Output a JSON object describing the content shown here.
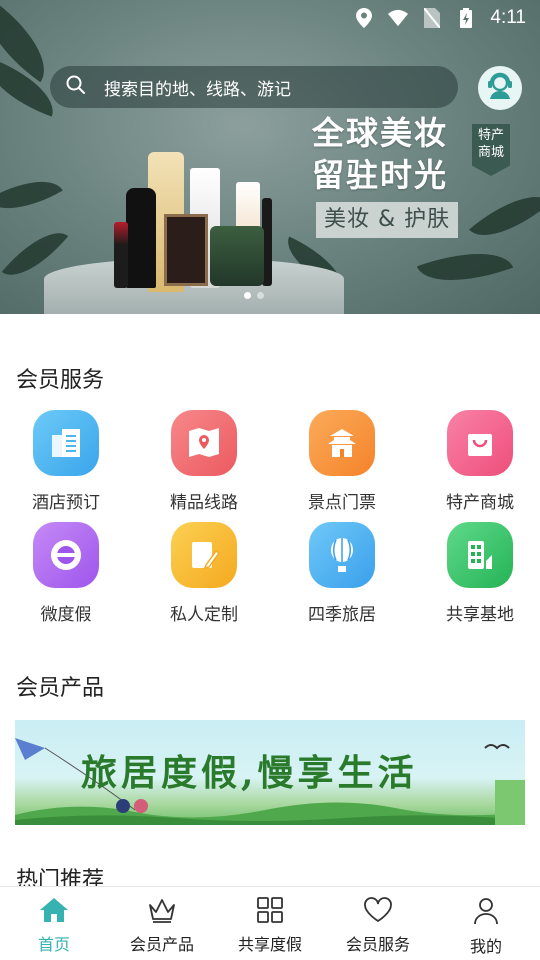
{
  "status_bar": {
    "time": "4:11"
  },
  "header": {
    "search_placeholder": "搜索目的地、线路、游记"
  },
  "banner": {
    "title_line1": "全球美妆",
    "title_line2": "留驻时光",
    "tag_line1": "特产",
    "tag_line2": "商城",
    "subtitle": "美妆 & 护肤",
    "slide_count": 2,
    "active_slide": 1
  },
  "member_services": {
    "title": "会员服务",
    "items": [
      {
        "label": "酒店预订",
        "icon": "hotel-icon",
        "color": "#4cb6ef"
      },
      {
        "label": "精品线路",
        "icon": "map-pin-icon",
        "color": "#f06a6a"
      },
      {
        "label": "景点门票",
        "icon": "temple-icon",
        "color": "#f7963d"
      },
      {
        "label": "特产商城",
        "icon": "shopping-bag-icon",
        "color": "#f35f8c"
      },
      {
        "label": "微度假",
        "icon": "eye-icon",
        "color": "#b069f0"
      },
      {
        "label": "私人定制",
        "icon": "edit-icon",
        "color": "#f7b92f"
      },
      {
        "label": "四季旅居",
        "icon": "balloon-icon",
        "color": "#48b3f2"
      },
      {
        "label": "共享基地",
        "icon": "building-icon",
        "color": "#34c36a"
      }
    ]
  },
  "member_products": {
    "title": "会员产品",
    "banner_text": "旅居度假,慢享生活"
  },
  "hot_recommend": {
    "title": "热门推荐"
  },
  "bottom_nav": {
    "items": [
      {
        "label": "首页",
        "icon": "home-icon",
        "active": true
      },
      {
        "label": "会员产品",
        "icon": "crown-icon",
        "active": false
      },
      {
        "label": "共享度假",
        "icon": "grid-icon",
        "active": false
      },
      {
        "label": "会员服务",
        "icon": "heart-icon",
        "active": false
      },
      {
        "label": "我的",
        "icon": "user-icon",
        "active": false
      }
    ],
    "active_color": "#36b3b0"
  }
}
